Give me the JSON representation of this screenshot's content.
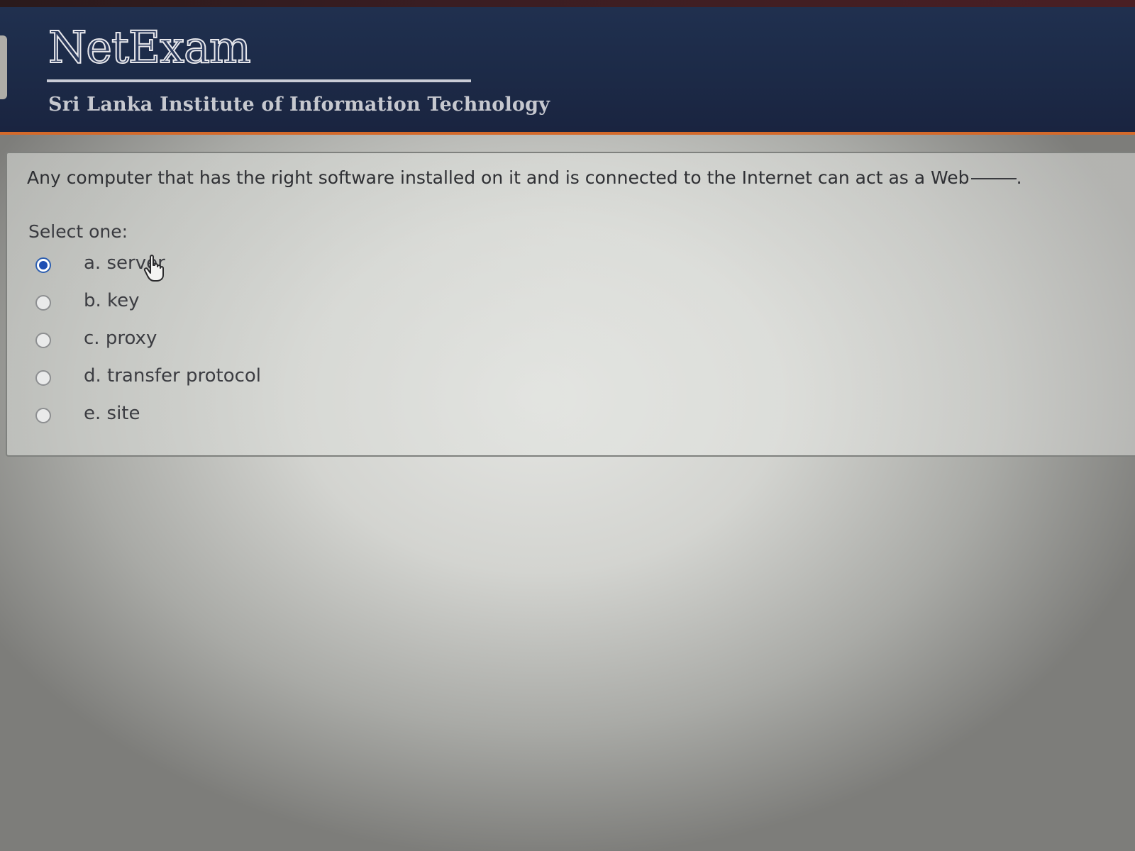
{
  "header": {
    "brand": "NetExam",
    "institute": "Sri Lanka Institute of Information Technology"
  },
  "question": {
    "text": "Any computer that has the right software installed on it and is connected to the Internet can act as a Web",
    "prompt": "Select one:",
    "options": [
      {
        "label": "a. server",
        "selected": true
      },
      {
        "label": "b. key",
        "selected": false
      },
      {
        "label": "c. proxy",
        "selected": false
      },
      {
        "label": "d. transfer protocol",
        "selected": false
      },
      {
        "label": "e. site",
        "selected": false
      }
    ]
  },
  "colors": {
    "header_bg": "#1c2a47",
    "header_accent": "#d46a2b",
    "radio_selected": "#1f4fb3"
  },
  "icons": {
    "cursor": "hand-pointer-icon"
  }
}
